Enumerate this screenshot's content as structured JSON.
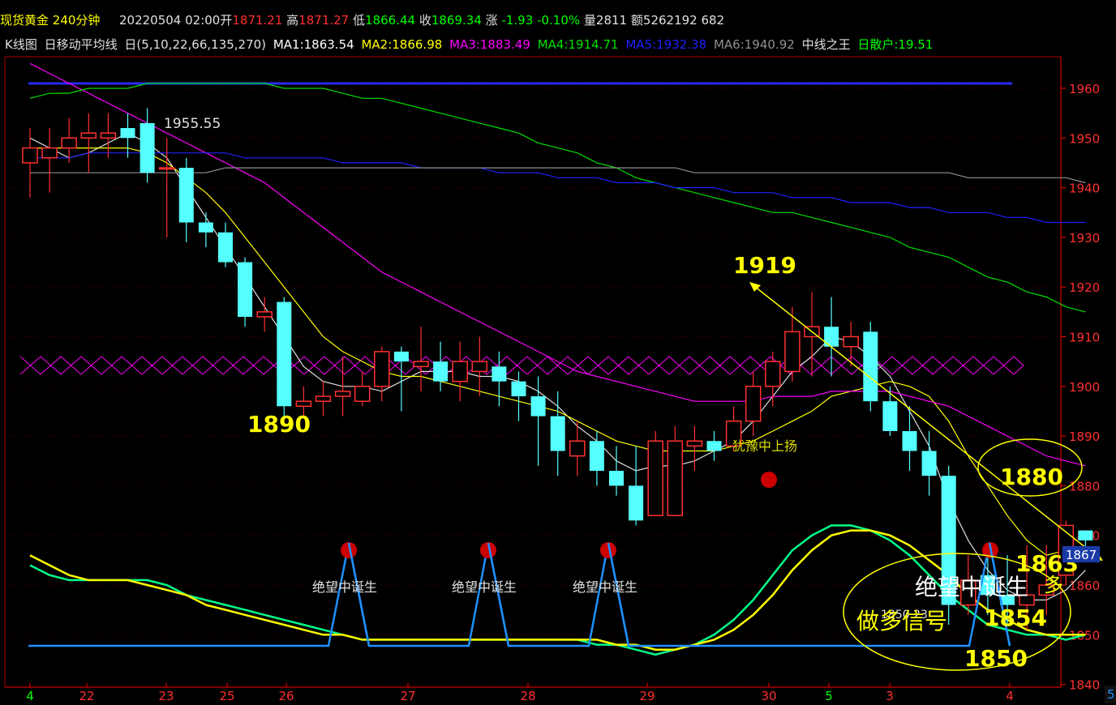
{
  "header": {
    "symbol": "现货黄金",
    "period": "240分钟",
    "date_time": "20220504 02:00",
    "open_label": "开",
    "open": "1871.21",
    "high_label": "高",
    "high": "1871.27",
    "low_label": "低",
    "low": "1866.44",
    "close_label": "收",
    "close": "1869.34",
    "change_label": "涨",
    "change": "-1.93",
    "change_pct": "-0.10%",
    "volume_label": "量",
    "volume": "2811",
    "amount_label": "额",
    "amount": "5262192 682"
  },
  "legend": {
    "chart_name": "K线图",
    "indicator": "日移动平均线",
    "params": "日(5,10,22,66,135,270)",
    "ma": [
      {
        "label": "MA1:1863.54",
        "color": "#ffffff"
      },
      {
        "label": "MA2:1866.98",
        "color": "#ffff00"
      },
      {
        "label": "MA3:1883.49",
        "color": "#ff00ff"
      },
      {
        "label": "MA4:1914.71",
        "color": "#00e000"
      },
      {
        "label": "MA5:1932.38",
        "color": "#2020ff"
      },
      {
        "label": "MA6:1940.92",
        "color": "#909090"
      }
    ],
    "extra_name": "中线之王",
    "extra_value_label": "日散户:19.51",
    "extra_value_color": "#00ff00"
  },
  "colors": {
    "up_candle": "#ff3030",
    "down_candle": "#55ffff",
    "axis": "#ff0000",
    "yellow_anno": "#ffff00"
  },
  "annotations": {
    "price_1955": "1955.55",
    "price_1919": "1919",
    "price_1890": "1890",
    "price_1880": "1880",
    "price_1863": "1863",
    "price_1854": "1854",
    "price_1850": "1850",
    "low_marker": "1850.23",
    "hesitate": "犹豫中上扬",
    "despair": "绝望中诞生",
    "long_signal": "做多信号",
    "long_small": "多",
    "current_price_tag": "1867",
    "right_edge_num": "5"
  },
  "chart_data": {
    "type": "candlestick",
    "yaxis_ticks": [
      1960,
      1950,
      1940,
      1930,
      1920,
      1910,
      1900,
      1890,
      1880,
      1870,
      1860,
      1850,
      1840
    ],
    "ylim": [
      1840,
      1962
    ],
    "xaxis_labels": [
      "4",
      "22",
      "23",
      "25",
      "26",
      "27",
      "28",
      "29",
      "30",
      "5",
      "3",
      "4"
    ],
    "xaxis_label_colors": [
      "#00ff00",
      "#ff3030",
      "#ff3030",
      "#ff3030",
      "#ff3030",
      "#ff3030",
      "#ff3030",
      "#ff3030",
      "#ff3030",
      "#00ff00",
      "#ff3030",
      "#ff3030"
    ],
    "candles": [
      [
        1945,
        1948,
        1938,
        1952
      ],
      [
        1946,
        1948,
        1939,
        1952
      ],
      [
        1948,
        1950,
        1945,
        1954
      ],
      [
        1950,
        1951,
        1943,
        1955
      ],
      [
        1950,
        1951,
        1946,
        1955
      ],
      [
        1952,
        1950,
        1946,
        1955
      ],
      [
        1953,
        1943,
        1941,
        1956
      ],
      [
        1944,
        1944,
        1930,
        1950
      ],
      [
        1944,
        1933,
        1929,
        1946
      ],
      [
        1933,
        1931,
        1928,
        1935
      ],
      [
        1931,
        1925,
        1924,
        1933
      ],
      [
        1925,
        1914,
        1912,
        1926
      ],
      [
        1914,
        1915,
        1911,
        1918
      ],
      [
        1917,
        1896,
        1894,
        1918
      ],
      [
        1896,
        1897,
        1894,
        1900
      ],
      [
        1897,
        1898,
        1894,
        1901
      ],
      [
        1898,
        1899,
        1894,
        1906
      ],
      [
        1897,
        1900,
        1896,
        1903
      ],
      [
        1900,
        1907,
        1897,
        1908
      ],
      [
        1907,
        1905,
        1895,
        1908
      ],
      [
        1904,
        1905,
        1899,
        1912
      ],
      [
        1905,
        1901,
        1899,
        1909
      ],
      [
        1901,
        1905,
        1897,
        1909
      ],
      [
        1903,
        1905,
        1898,
        1910
      ],
      [
        1904,
        1901,
        1896,
        1907
      ],
      [
        1901,
        1898,
        1893,
        1903
      ],
      [
        1898,
        1894,
        1884,
        1902
      ],
      [
        1894,
        1887,
        1882,
        1899
      ],
      [
        1886,
        1889,
        1882,
        1893
      ],
      [
        1889,
        1883,
        1880,
        1891
      ],
      [
        1883,
        1880,
        1878,
        1888
      ],
      [
        1880,
        1873,
        1872,
        1888
      ],
      [
        1874,
        1889,
        1874,
        1891
      ],
      [
        1874,
        1889,
        1874,
        1892
      ],
      [
        1888,
        1889,
        1883,
        1892
      ],
      [
        1889,
        1887,
        1885,
        1891
      ],
      [
        1888,
        1893,
        1887,
        1896
      ],
      [
        1893,
        1900,
        1890,
        1903
      ],
      [
        1900,
        1905,
        1896,
        1907
      ],
      [
        1903,
        1911,
        1901,
        1916
      ],
      [
        1910,
        1912,
        1902,
        1919
      ],
      [
        1912,
        1908,
        1902,
        1918
      ],
      [
        1908,
        1910,
        1904,
        1913
      ],
      [
        1911,
        1897,
        1895,
        1913
      ],
      [
        1897,
        1891,
        1890,
        1900
      ],
      [
        1891,
        1887,
        1883,
        1896
      ],
      [
        1887,
        1882,
        1878,
        1891
      ],
      [
        1882,
        1856,
        1852,
        1884
      ],
      [
        1856,
        1861,
        1854,
        1866
      ],
      [
        1862,
        1858,
        1854,
        1867
      ],
      [
        1858,
        1856,
        1852,
        1866
      ],
      [
        1856,
        1858,
        1851,
        1868
      ],
      [
        1858,
        1860,
        1854,
        1868
      ],
      [
        1862,
        1872,
        1860,
        1873
      ],
      [
        1871,
        1869,
        1866,
        1871
      ]
    ],
    "series": [
      {
        "name": "MA1",
        "color": "#e0e0e0",
        "values": [
          1950,
          1948,
          1946,
          1947,
          1949,
          1951,
          1949,
          1946,
          1940,
          1934,
          1928,
          1922,
          1916,
          1910,
          1904,
          1901,
          1900,
          1900,
          1899,
          1901,
          1903,
          1903,
          1903,
          1902,
          1902,
          1901,
          1899,
          1896,
          1892,
          1889,
          1885,
          1883,
          1884,
          1884,
          1885,
          1887,
          1889,
          1893,
          1898,
          1903,
          1906,
          1910,
          1909,
          1906,
          1902,
          1895,
          1888,
          1877,
          1869,
          1863,
          1859,
          1857,
          1857,
          1859,
          1863
        ]
      },
      {
        "name": "MA2",
        "color": "#ffff00",
        "values": [
          1948,
          1948,
          1948,
          1948,
          1948,
          1948,
          1947,
          1945,
          1942,
          1939,
          1935,
          1930,
          1925,
          1920,
          1915,
          1910,
          1907,
          1905,
          1903,
          1902,
          1902,
          1901,
          1900,
          1899,
          1898,
          1897,
          1896,
          1895,
          1893,
          1891,
          1889,
          1888,
          1887,
          1887,
          1887,
          1887,
          1888,
          1889,
          1891,
          1893,
          1895,
          1898,
          1899,
          1900,
          1901,
          1900,
          1898,
          1893,
          1886,
          1880,
          1874,
          1869,
          1866,
          1867,
          1867
        ]
      },
      {
        "name": "MA3",
        "color": "#ff00ff",
        "values": [
          1965,
          1963,
          1961,
          1959,
          1957,
          1955,
          1953,
          1951,
          1949,
          1947,
          1945,
          1943,
          1941,
          1938,
          1935,
          1932,
          1929,
          1926,
          1923,
          1921,
          1919,
          1917,
          1915,
          1913,
          1911,
          1909,
          1907,
          1905,
          1903,
          1902,
          1901,
          1900,
          1899,
          1898,
          1897,
          1897,
          1897,
          1897,
          1898,
          1898,
          1898,
          1899,
          1899,
          1899,
          1899,
          1898,
          1897,
          1896,
          1894,
          1892,
          1890,
          1888,
          1886,
          1885,
          1884
        ]
      },
      {
        "name": "MA4",
        "color": "#00e000",
        "values": [
          1958,
          1959,
          1959,
          1960,
          1960,
          1960,
          1961,
          1961,
          1961,
          1961,
          1961,
          1961,
          1961,
          1960,
          1960,
          1960,
          1959,
          1958,
          1958,
          1957,
          1956,
          1955,
          1954,
          1953,
          1952,
          1951,
          1949,
          1948,
          1947,
          1945,
          1944,
          1942,
          1941,
          1940,
          1939,
          1938,
          1937,
          1936,
          1935,
          1935,
          1934,
          1933,
          1932,
          1931,
          1930,
          1928,
          1927,
          1926,
          1924,
          1922,
          1921,
          1919,
          1918,
          1916,
          1915
        ]
      },
      {
        "name": "MA5",
        "color": "#2020ff",
        "values": [
          1946,
          1946,
          1946,
          1947,
          1947,
          1947,
          1947,
          1947,
          1947,
          1947,
          1947,
          1946,
          1946,
          1946,
          1946,
          1946,
          1945,
          1945,
          1945,
          1945,
          1944,
          1944,
          1944,
          1944,
          1943,
          1943,
          1943,
          1942,
          1942,
          1942,
          1941,
          1941,
          1941,
          1940,
          1940,
          1940,
          1939,
          1939,
          1939,
          1938,
          1938,
          1938,
          1937,
          1937,
          1937,
          1936,
          1936,
          1935,
          1935,
          1935,
          1934,
          1934,
          1933,
          1933,
          1933
        ]
      },
      {
        "name": "MA6",
        "color": "#909090",
        "values": [
          1943,
          1943,
          1943,
          1943,
          1943,
          1943,
          1943,
          1943,
          1943,
          1943,
          1944,
          1944,
          1944,
          1944,
          1944,
          1944,
          1944,
          1944,
          1944,
          1944,
          1944,
          1944,
          1944,
          1944,
          1944,
          1944,
          1944,
          1944,
          1944,
          1944,
          1944,
          1944,
          1944,
          1944,
          1943,
          1943,
          1943,
          1943,
          1943,
          1943,
          1943,
          1943,
          1943,
          1943,
          1943,
          1943,
          1943,
          1943,
          1942,
          1942,
          1942,
          1942,
          1942,
          1942,
          1941
        ]
      },
      {
        "name": "中线之王-green",
        "color": "#00ff88",
        "values": [
          1864,
          1862,
          1861,
          1861,
          1861,
          1861,
          1861,
          1860,
          1858,
          1857,
          1856,
          1855,
          1854,
          1853,
          1852,
          1851,
          1850,
          1849,
          1849,
          1849,
          1849,
          1849,
          1849,
          1849,
          1849,
          1849,
          1849,
          1849,
          1849,
          1848,
          1848,
          1847,
          1846,
          1847,
          1848,
          1850,
          1853,
          1857,
          1862,
          1867,
          1870,
          1872,
          1872,
          1871,
          1869,
          1866,
          1862,
          1858,
          1855,
          1852,
          1851,
          1850,
          1850,
          1849,
          1850
        ]
      },
      {
        "name": "中线之王-yellow",
        "color": "#ffff00",
        "values": [
          1866,
          1864,
          1862,
          1861,
          1861,
          1861,
          1860,
          1859,
          1858,
          1856,
          1855,
          1854,
          1853,
          1852,
          1851,
          1850,
          1850,
          1849,
          1849,
          1849,
          1849,
          1849,
          1849,
          1849,
          1849,
          1849,
          1849,
          1849,
          1849,
          1849,
          1848,
          1848,
          1847,
          1847,
          1848,
          1849,
          1851,
          1854,
          1858,
          1863,
          1867,
          1870,
          1871,
          1871,
          1870,
          1868,
          1865,
          1862,
          1858,
          1855,
          1853,
          1851,
          1850,
          1850,
          1850
        ]
      }
    ]
  }
}
